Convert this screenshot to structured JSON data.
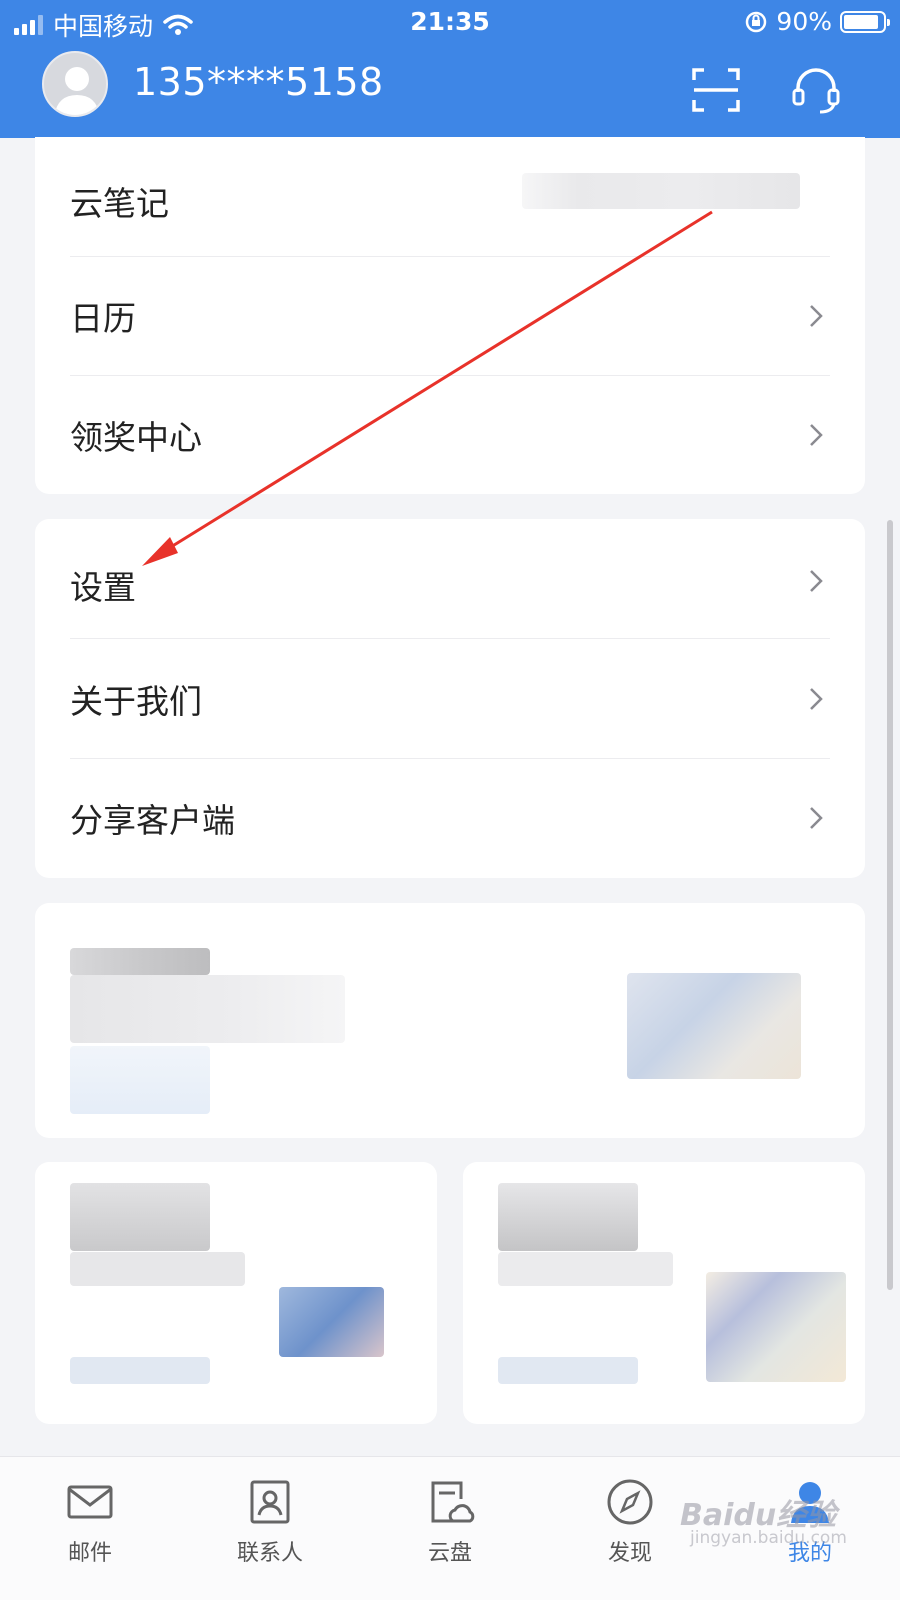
{
  "status_bar": {
    "carrier": "中国移动",
    "time": "21:35",
    "battery": "90%",
    "battery_level": 0.9,
    "icons": [
      "signal-icon",
      "wifi-icon",
      "rotation-lock-icon",
      "battery-icon"
    ]
  },
  "header": {
    "account": "135****5158",
    "icons": [
      "avatar",
      "scan-icon",
      "headset-icon"
    ],
    "bg_color": "#3e86e6"
  },
  "menu_group_1": {
    "items": [
      {
        "label": "云笔记"
      },
      {
        "label": "日历"
      },
      {
        "label": "领奖中心"
      }
    ]
  },
  "menu_group_2": {
    "items": [
      {
        "label": "设置"
      },
      {
        "label": "关于我们"
      },
      {
        "label": "分享客户端"
      }
    ]
  },
  "tabbar": {
    "tabs": [
      {
        "label": "邮件",
        "icon": "mail-icon"
      },
      {
        "label": "联系人",
        "icon": "contacts-icon"
      },
      {
        "label": "云盘",
        "icon": "cloud-drive-icon"
      },
      {
        "label": "发现",
        "icon": "compass-icon"
      },
      {
        "label": "我的",
        "icon": "profile-icon",
        "active": true
      }
    ],
    "active_color": "#3e86e6"
  },
  "annotation": {
    "arrow_color": "#e8322a",
    "points_to": "设置"
  },
  "watermark": {
    "text": "Baidu经验",
    "sub": "jingyan.baidu.com"
  }
}
